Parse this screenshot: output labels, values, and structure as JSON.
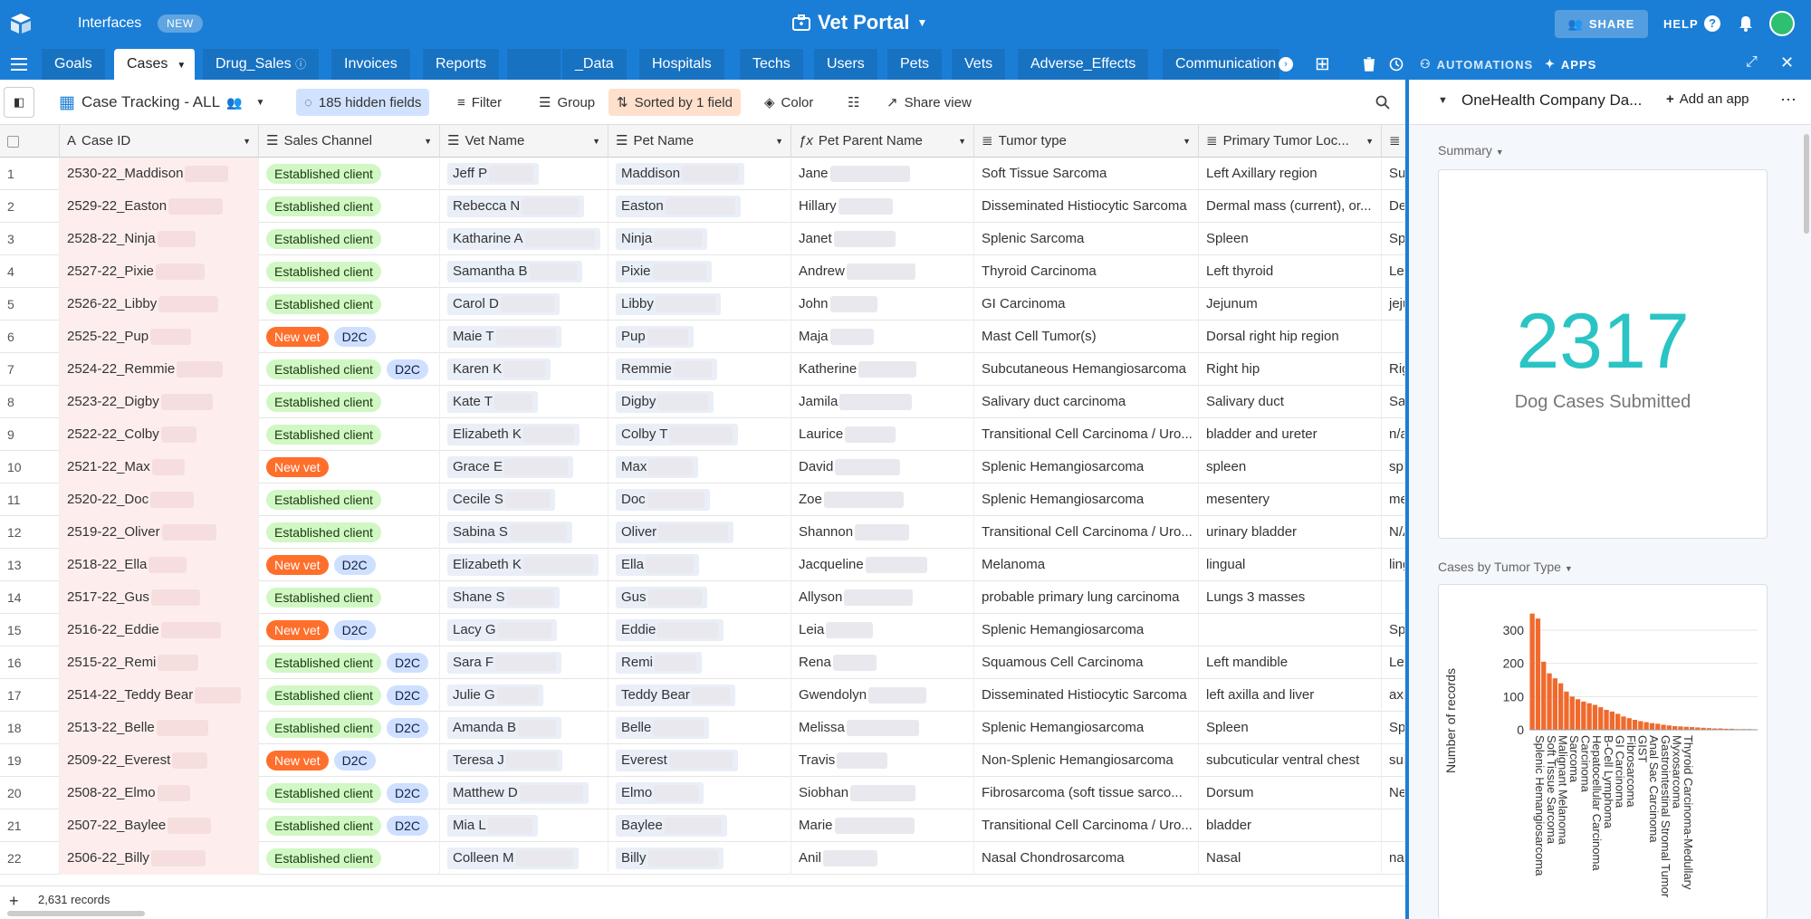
{
  "topbar": {
    "interfaces_label": "Interfaces",
    "new_badge": "NEW",
    "base_title": "Vet Portal",
    "share_label": "SHARE",
    "help_label": "HELP"
  },
  "tabs": [
    "Goals",
    "Cases",
    "Drug_Sales",
    "Invoices",
    "Reports",
    "_Data",
    "Hospitals",
    "Techs",
    "Users",
    "Pets",
    "Vets",
    "Adverse_Effects",
    "Communication"
  ],
  "tabbar": {
    "automations_label": "AUTOMATIONS",
    "apps_label": "APPS"
  },
  "toolbar": {
    "view_name": "Case Tracking - ALL",
    "hidden_fields": "185 hidden fields",
    "filter": "Filter",
    "group": "Group",
    "sorted": "Sorted by 1 field",
    "color": "Color",
    "share_view": "Share view"
  },
  "columns": [
    "Case ID",
    "Sales Channel",
    "Vet Name",
    "Pet Name",
    "Pet Parent Name",
    "Tumor type",
    "Primary Tumor Loc..."
  ],
  "rows": [
    {
      "n": "1",
      "case_id": "2530-22_Maddison",
      "channels": [
        "Established client"
      ],
      "vet": "Jeff P",
      "pet": "Maddison",
      "parent": "Jane",
      "tumor": "Soft Tissue Sarcoma",
      "loc": "Left Axillary region",
      "extra": "Su"
    },
    {
      "n": "2",
      "case_id": "2529-22_Easton",
      "channels": [
        "Established client"
      ],
      "vet": "Rebecca N",
      "pet": "Easton",
      "parent": "Hillary",
      "tumor": "Disseminated Histiocytic Sarcoma",
      "loc": "Dermal mass (current), or...",
      "extra": "De"
    },
    {
      "n": "3",
      "case_id": "2528-22_Ninja",
      "channels": [
        "Established client"
      ],
      "vet": "Katharine A",
      "pet": "Ninja",
      "parent": "Janet",
      "tumor": "Splenic Sarcoma",
      "loc": "Spleen",
      "extra": "Sp"
    },
    {
      "n": "4",
      "case_id": "2527-22_Pixie",
      "channels": [
        "Established client"
      ],
      "vet": "Samantha B",
      "pet": "Pixie",
      "parent": "Andrew",
      "tumor": "Thyroid Carcinoma",
      "loc": "Left thyroid",
      "extra": "Let"
    },
    {
      "n": "5",
      "case_id": "2526-22_Libby",
      "channels": [
        "Established client"
      ],
      "vet": "Carol D",
      "pet": "Libby",
      "parent": "John",
      "tumor": "GI Carcinoma",
      "loc": "Jejunum",
      "extra": "jeju"
    },
    {
      "n": "6",
      "case_id": "2525-22_Pup",
      "channels": [
        "New vet",
        "D2C"
      ],
      "vet": "Maie T",
      "pet": "Pup",
      "parent": "Maja",
      "tumor": "Mast Cell Tumor(s)",
      "loc": "Dorsal right hip region",
      "extra": ""
    },
    {
      "n": "7",
      "case_id": "2524-22_Remmie",
      "channels": [
        "Established client",
        "D2C"
      ],
      "vet": "Karen K",
      "pet": "Remmie",
      "parent": "Katherine",
      "tumor": "Subcutaneous Hemangiosarcoma",
      "loc": "Right hip",
      "extra": "Rig"
    },
    {
      "n": "8",
      "case_id": "2523-22_Digby",
      "channels": [
        "Established client"
      ],
      "vet": "Kate T",
      "pet": "Digby",
      "parent": "Jamila",
      "tumor": "Salivary duct carcinoma",
      "loc": "Salivary duct",
      "extra": "Sal"
    },
    {
      "n": "9",
      "case_id": "2522-22_Colby",
      "channels": [
        "Established client"
      ],
      "vet": "Elizabeth K",
      "pet": "Colby T",
      "parent": "Laurice",
      "tumor": "Transitional Cell Carcinoma / Uro...",
      "loc": "bladder and ureter",
      "extra": "n/a"
    },
    {
      "n": "10",
      "case_id": "2521-22_Max",
      "channels": [
        "New vet"
      ],
      "vet": "Grace E",
      "pet": "Max",
      "parent": "David",
      "tumor": "Splenic Hemangiosarcoma",
      "loc": "spleen",
      "extra": "spl"
    },
    {
      "n": "11",
      "case_id": "2520-22_Doc",
      "channels": [
        "Established client"
      ],
      "vet": "Cecile S",
      "pet": "Doc",
      "parent": "Zoe",
      "tumor": "Splenic Hemangiosarcoma",
      "loc": "mesentery",
      "extra": "me"
    },
    {
      "n": "12",
      "case_id": "2519-22_Oliver",
      "channels": [
        "Established client"
      ],
      "vet": "Sabina S",
      "pet": "Oliver",
      "parent": "Shannon",
      "tumor": "Transitional Cell Carcinoma / Uro...",
      "loc": "urinary bladder",
      "extra": "N/A"
    },
    {
      "n": "13",
      "case_id": "2518-22_Ella",
      "channels": [
        "New vet",
        "D2C"
      ],
      "vet": "Elizabeth K",
      "pet": "Ella",
      "parent": "Jacqueline",
      "tumor": "Melanoma",
      "loc": "lingual",
      "extra": "ling"
    },
    {
      "n": "14",
      "case_id": "2517-22_Gus",
      "channels": [
        "Established client"
      ],
      "vet": "Shane S",
      "pet": "Gus",
      "parent": "Allyson",
      "tumor": "probable primary lung carcinoma",
      "loc": "Lungs 3 masses",
      "extra": ""
    },
    {
      "n": "15",
      "case_id": "2516-22_Eddie",
      "channels": [
        "New vet",
        "D2C"
      ],
      "vet": "Lacy G",
      "pet": "Eddie",
      "parent": "Leia",
      "tumor": "Splenic Hemangiosarcoma",
      "loc": "",
      "extra": "Sp"
    },
    {
      "n": "16",
      "case_id": "2515-22_Remi",
      "channels": [
        "Established client",
        "D2C"
      ],
      "vet": "Sara F",
      "pet": "Remi",
      "parent": "Rena",
      "tumor": "Squamous Cell Carcinoma",
      "loc": "Left mandible",
      "extra": "Let"
    },
    {
      "n": "17",
      "case_id": "2514-22_Teddy Bear",
      "channels": [
        "Established client",
        "D2C"
      ],
      "vet": "Julie G",
      "pet": "Teddy Bear",
      "parent": "Gwendolyn",
      "tumor": "Disseminated Histiocytic Sarcoma",
      "loc": "left axilla and liver",
      "extra": "axi"
    },
    {
      "n": "18",
      "case_id": "2513-22_Belle",
      "channels": [
        "Established client",
        "D2C"
      ],
      "vet": "Amanda B",
      "pet": "Belle",
      "parent": "Melissa",
      "tumor": "Splenic Hemangiosarcoma",
      "loc": "Spleen",
      "extra": "Sp"
    },
    {
      "n": "19",
      "case_id": "2509-22_Everest",
      "channels": [
        "New vet",
        "D2C"
      ],
      "vet": "Teresa J",
      "pet": "Everest",
      "parent": "Travis",
      "tumor": "Non-Splenic Hemangiosarcoma",
      "loc": "subcuticular ventral chest",
      "extra": "sub"
    },
    {
      "n": "20",
      "case_id": "2508-22_Elmo",
      "channels": [
        "Established client",
        "D2C"
      ],
      "vet": "Matthew D",
      "pet": "Elmo",
      "parent": "Siobhan",
      "tumor": "Fibrosarcoma (soft tissue sarco...",
      "loc": "Dorsum",
      "extra": "Ne"
    },
    {
      "n": "21",
      "case_id": "2507-22_Baylee",
      "channels": [
        "Established client",
        "D2C"
      ],
      "vet": "Mia L",
      "pet": "Baylee",
      "parent": "Marie",
      "tumor": "Transitional Cell Carcinoma / Uro...",
      "loc": "bladder",
      "extra": ""
    },
    {
      "n": "22",
      "case_id": "2506-22_Billy",
      "channels": [
        "Established client"
      ],
      "vet": "Colleen M",
      "pet": "Billy",
      "parent": "Anil",
      "tumor": "Nasal Chondrosarcoma",
      "loc": "Nasal",
      "extra": "nas"
    }
  ],
  "footer": {
    "records": "2,631 records"
  },
  "panel": {
    "title": "OneHealth Company Da...",
    "add_app": "Add an app",
    "summary_label": "Summary",
    "big_number": "2317",
    "big_caption": "Dog Cases Submitted",
    "chart_label": "Cases by Tumor Type",
    "accent": "#2bc4c4",
    "bar_color": "#f06a2d"
  },
  "chart_data": {
    "type": "bar",
    "title": "Cases by Tumor Type",
    "ylabel": "Number of records",
    "ylim": [
      0,
      360
    ],
    "yticks": [
      0,
      100,
      200,
      300
    ],
    "tick_labels": [
      "Splenic Hemangiosarcoma",
      "Soft Tissue Sarcoma",
      "Malignant Melanoma",
      "Sarcoma",
      "Carcinoma",
      "Hepatocellular Carcinoma",
      "B-Cell Lymphoma",
      "GI Carcinoma",
      "Fibrosarcoma",
      "GIST",
      "Anal Sac Carcinoma",
      "Gastrointestinal Stromal Tumor",
      "Myxosarcoma",
      "Thyroid Carcinoma-Medullary"
    ],
    "tick_positions": [
      0,
      2,
      4,
      6,
      8,
      10,
      12,
      14,
      16,
      18,
      20,
      22,
      24,
      26
    ],
    "values": [
      350,
      335,
      205,
      170,
      155,
      140,
      115,
      100,
      92,
      85,
      80,
      75,
      68,
      60,
      55,
      48,
      40,
      35,
      30,
      26,
      23,
      20,
      18,
      15,
      13,
      11,
      10,
      9,
      8,
      7,
      6,
      5,
      4,
      4,
      3,
      3,
      2,
      2,
      2,
      1
    ]
  }
}
